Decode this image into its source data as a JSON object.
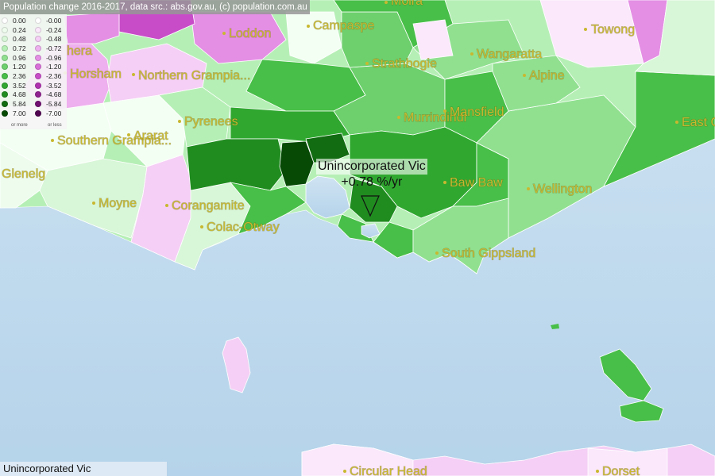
{
  "title": "Population change 2016-2017, data src.: abs.gov.au, (c) population.com.au",
  "legend": {
    "positive": [
      "0.00",
      "0.24",
      "0.48",
      "0.72",
      "0.96",
      "1.20",
      "2.36",
      "3.52",
      "4.68",
      "5.84",
      "7.00"
    ],
    "negative": [
      "-0.00",
      "-0.24",
      "-0.48",
      "-0.72",
      "-0.96",
      "-1.20",
      "-2.36",
      "-3.52",
      "-4.68",
      "-5.84",
      "-7.00"
    ],
    "positive_foot": "or more",
    "negative_foot": "or less",
    "positive_colors": [
      "#ffffff",
      "#eefcee",
      "#d8f6d8",
      "#b6efb6",
      "#90e090",
      "#6dd06d",
      "#48bf48",
      "#30a830",
      "#208c20",
      "#126c12",
      "#064a06"
    ],
    "negative_colors": [
      "#ffffff",
      "#fbe8fb",
      "#f5cff5",
      "#eeb0ee",
      "#e48fe4",
      "#d96fd9",
      "#c84cc8",
      "#b030b0",
      "#902090",
      "#701070",
      "#500450"
    ]
  },
  "places": [
    "Moira",
    "Campaspe",
    "Loddon",
    "Towong",
    "Strathbogie",
    "Wangaratta",
    "Alpine",
    "Horsham",
    "Northern Grampia...",
    "Murrindindi",
    "Mansfield",
    "Pyrenees",
    "Southern Grampia...",
    "Ararat",
    "Glenelg",
    "East Gi",
    "Baw Baw",
    "Wellington",
    "Moyne",
    "Corangamite",
    "Colac-Otway",
    "South Gippsland",
    "Circular Head",
    "Dorset",
    "hera"
  ],
  "callout": {
    "name": "Unincorporated Vic",
    "value": "+0.78 %/yr"
  },
  "status": "Unincorporated Vic"
}
